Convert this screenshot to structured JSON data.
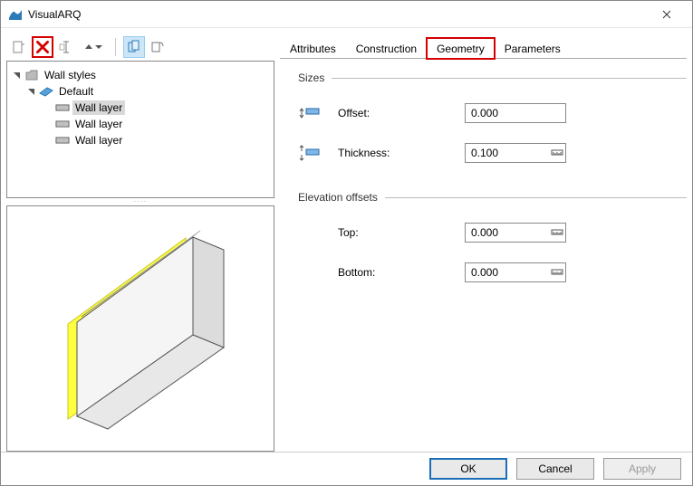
{
  "window": {
    "title": "VisualARQ"
  },
  "toolbar": {
    "new_tip": "New",
    "delete_tip": "Delete",
    "rename_tip": "Rename",
    "dup_tip": "Duplicate",
    "view1_tip": "3D preview",
    "view2_tip": "2D preview"
  },
  "tree": {
    "root": "Wall styles",
    "default_label": "Default",
    "layers": [
      "Wall layer",
      "Wall layer",
      "Wall layer"
    ],
    "selected": 0
  },
  "tabs": [
    "Attributes",
    "Construction",
    "Geometry",
    "Parameters"
  ],
  "active_tab": 2,
  "geometry": {
    "sizes_title": "Sizes",
    "offset_label": "Offset:",
    "offset_value": "0.000",
    "thickness_label": "Thickness:",
    "thickness_value": "0.100",
    "elev_title": "Elevation offsets",
    "top_label": "Top:",
    "top_value": "0.000",
    "bottom_label": "Bottom:",
    "bottom_value": "0.000"
  },
  "buttons": {
    "ok": "OK",
    "cancel": "Cancel",
    "apply": "Apply"
  }
}
